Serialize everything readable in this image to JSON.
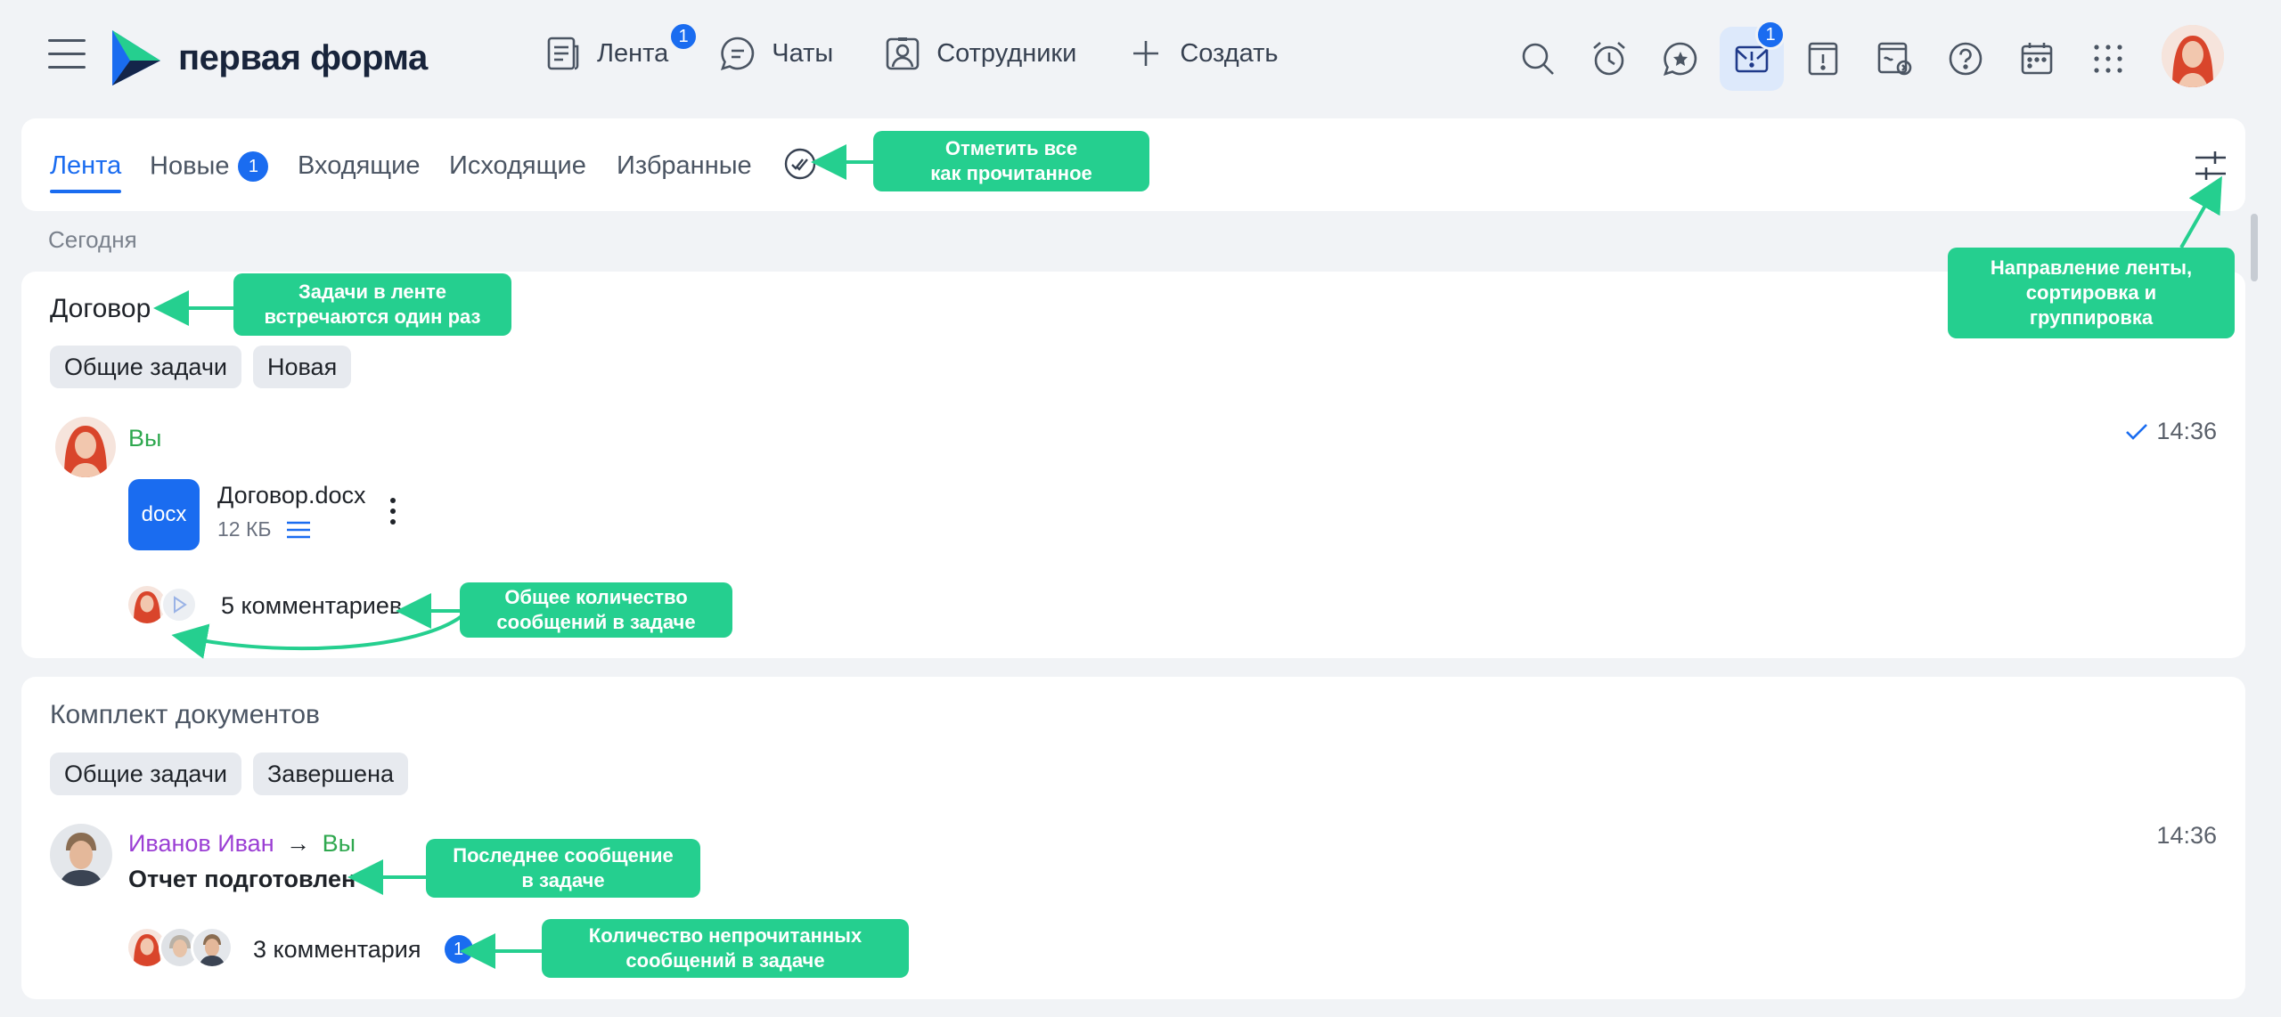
{
  "header": {
    "logo_text": "первая форма",
    "nav": [
      {
        "label": "Лента",
        "icon": "feed-icon",
        "badge": "1"
      },
      {
        "label": "Чаты",
        "icon": "chat-icon"
      },
      {
        "label": "Сотрудники",
        "icon": "employees-icon"
      },
      {
        "label": "Создать",
        "icon": "plus-icon"
      }
    ],
    "tools": [
      {
        "icon": "search-icon"
      },
      {
        "icon": "alarm-clock-icon"
      },
      {
        "icon": "favorite-star-icon"
      },
      {
        "icon": "mail-important-icon",
        "badge": "1",
        "active": true
      },
      {
        "icon": "alert-icon"
      },
      {
        "icon": "document-transfer-icon"
      },
      {
        "icon": "help-icon"
      },
      {
        "icon": "calendar-icon"
      },
      {
        "icon": "apps-grid-icon"
      }
    ]
  },
  "tabs": [
    {
      "label": "Лента",
      "active": true
    },
    {
      "label": "Новые",
      "badge": "1"
    },
    {
      "label": "Входящие"
    },
    {
      "label": "Исходящие"
    },
    {
      "label": "Избранные"
    }
  ],
  "section_label": "Сегодня",
  "cards": [
    {
      "title": "Договор",
      "chips": [
        "Общие задачи",
        "Новая"
      ],
      "author": "Вы",
      "time": "14:36",
      "file": {
        "ext": "docx",
        "name": "Договор.docx",
        "size": "12 КБ"
      },
      "comments": "5 комментариев"
    },
    {
      "title": "Комплект документов",
      "chips": [
        "Общие задачи",
        "Завершена"
      ],
      "author": "Иванов Иван",
      "recipient": "Вы",
      "time": "14:36",
      "message": "Отчет подготовлен",
      "comments": "3 комментария",
      "unread": "1"
    }
  ],
  "callouts": {
    "mark_all_line1": "Отметить все",
    "mark_all_line2": "как прочитанное",
    "direction_line1": "Направление ленты,",
    "direction_line2": "сортировка и",
    "direction_line3": "группировка",
    "tasks_once_line1": "Задачи в ленте",
    "tasks_once_line2": "встречаются один раз",
    "total_line1": "Общее количество",
    "total_line2": "сообщений в задаче",
    "last_line1": "Последнее сообщение",
    "last_line2": "в задаче",
    "unread_line1": "Количество непрочитанных",
    "unread_line2": "сообщений в задаче"
  },
  "colors": {
    "accent": "#1a6cf0",
    "callout": "#25cf8f",
    "author_self": "#2fa84f",
    "author_other": "#9b3fd4"
  }
}
